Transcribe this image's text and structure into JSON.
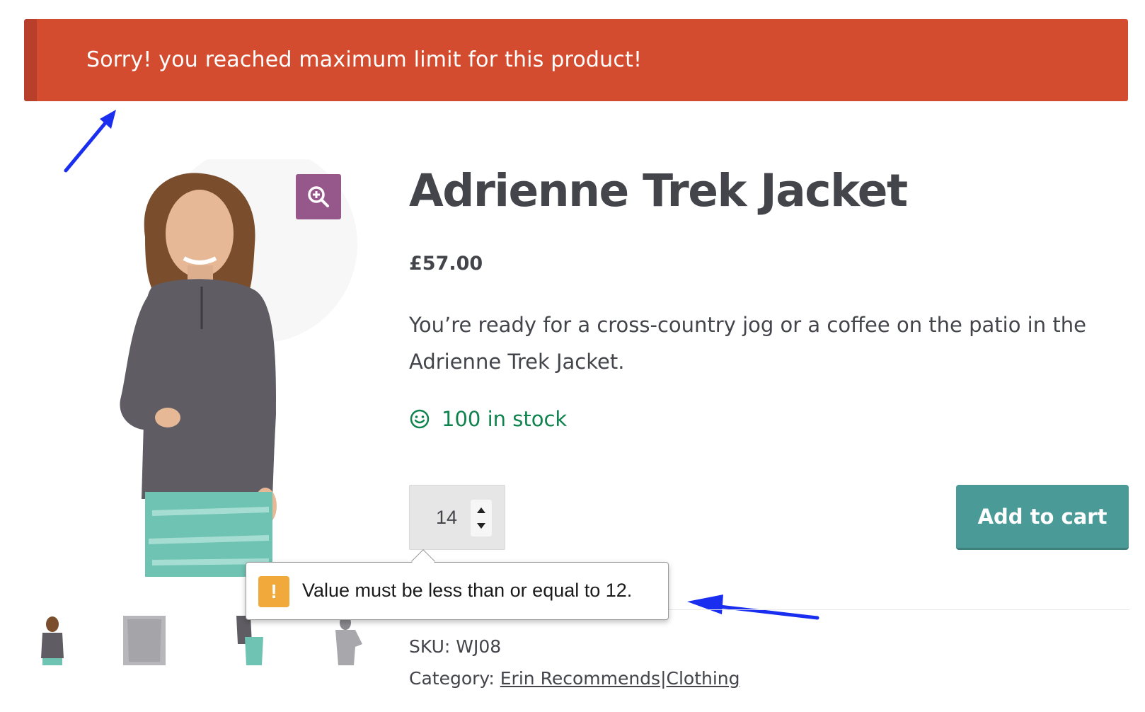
{
  "notice": {
    "message": "Sorry! you reached maximum limit for this product!",
    "background": "#d44c2f"
  },
  "product": {
    "title": "Adrienne Trek Jacket",
    "price": "£57.00",
    "description": "You’re ready for a cross-country jog or a coffee on the patio in the Adrienne Trek Jacket.",
    "stock": "100 in stock",
    "stock_icon": "smiley-icon",
    "stock_color": "#0f834d"
  },
  "purchase": {
    "quantity": "14",
    "add_to_cart_label": "Add to cart",
    "button_color": "#4a9b97"
  },
  "validation": {
    "message": "Value must be less than or equal to 12.",
    "icon": "warning-icon",
    "icon_glyph": "!"
  },
  "meta": {
    "sku_label": "SKU:",
    "sku_value": "WJ08",
    "category_label": "Category:",
    "categories": [
      "Erin Recommends",
      "Clothing"
    ],
    "separator": "|"
  },
  "gallery": {
    "zoom_icon": "zoom-in-icon",
    "zoom_color": "#96588a"
  }
}
